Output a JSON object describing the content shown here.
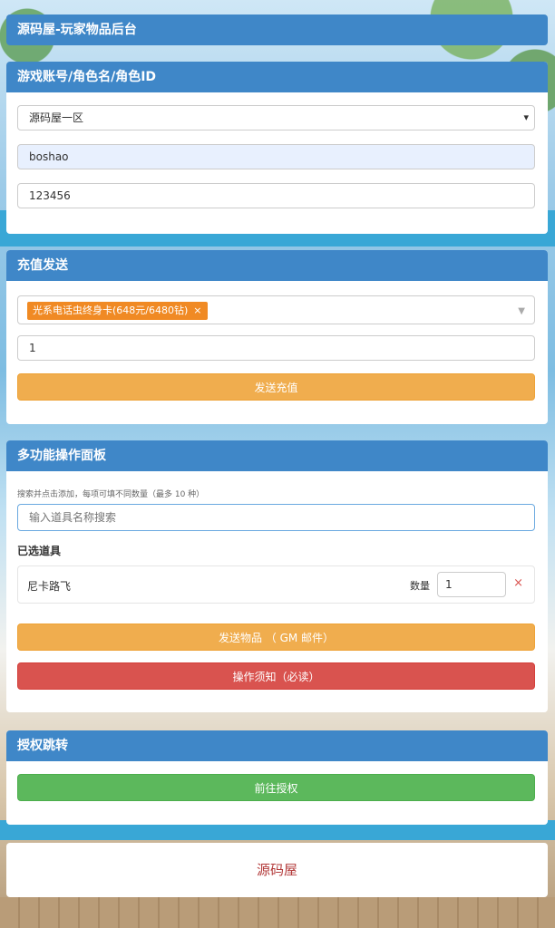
{
  "header": {
    "title": "源码屋-玩家物品后台"
  },
  "account": {
    "title": "游戏账号/角色名/角色ID",
    "server": "源码屋一区",
    "account": "boshao",
    "role_id": "123456"
  },
  "recharge": {
    "title": "充值发送",
    "selected_tag": "光系电话虫终身卡(648元/6480钻)",
    "tag_remove": "×",
    "quantity": "1",
    "send_button": "发送充值"
  },
  "multi": {
    "title": "多功能操作面板",
    "hint": "搜索并点击添加，每项可填不同数量（最多 10 种）",
    "search_placeholder": "输入道具名称搜索",
    "selected_title": "已选道具",
    "items": [
      {
        "name": "尼卡路飞",
        "qty_label": "数量",
        "qty": "1",
        "remove": "×"
      }
    ],
    "send_button": "发送物品 （ GM 邮件）",
    "notice_button": "操作须知（必读）"
  },
  "auth": {
    "title": "授权跳转",
    "button": "前往授权"
  },
  "footer": {
    "text": "源码屋"
  },
  "colors": {
    "header_blue": "#3f87c8",
    "warning": "#f0ad4e",
    "danger": "#d9534f",
    "success": "#5cb85c",
    "tag": "#f08a24"
  }
}
